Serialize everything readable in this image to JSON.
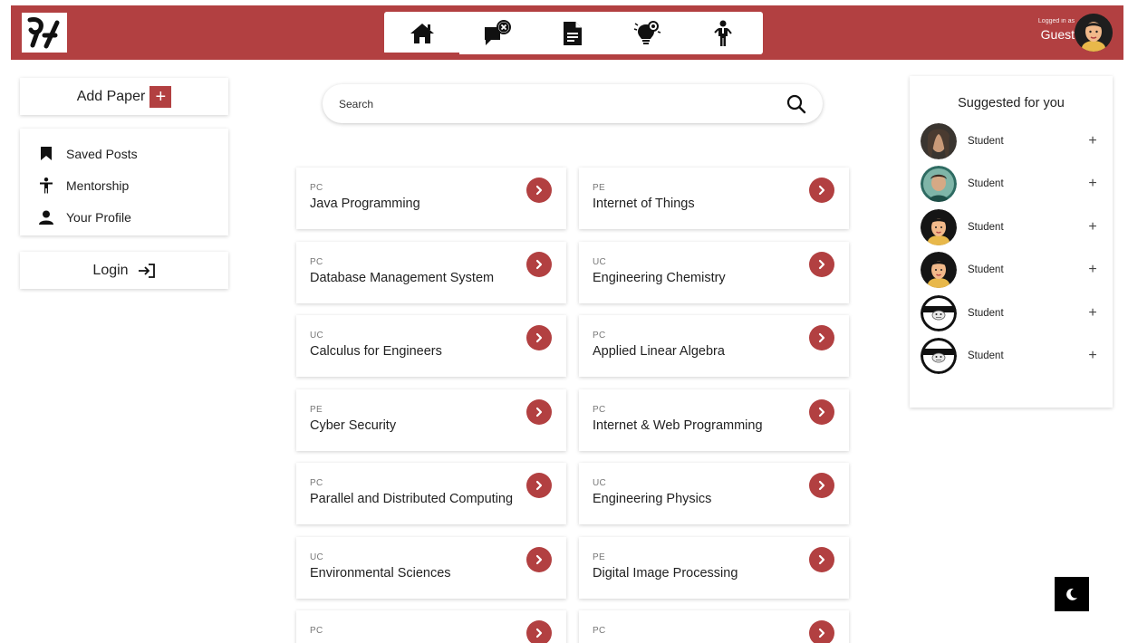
{
  "header": {
    "logged_in_label": "Logged in as",
    "user_name": "Guest",
    "nav": [
      {
        "icon": "home-icon",
        "active": true
      },
      {
        "icon": "chat-close-icon",
        "active": false
      },
      {
        "icon": "document-icon",
        "active": false
      },
      {
        "icon": "lightbulb-gear-icon",
        "active": false
      },
      {
        "icon": "mentor-person-icon",
        "active": false
      }
    ]
  },
  "sidebar": {
    "add_paper_label": "Add Paper",
    "menu": [
      {
        "label": "Saved Posts",
        "icon": "bookmark-icon"
      },
      {
        "label": "Mentorship",
        "icon": "person-stand-icon"
      },
      {
        "label": "Your Profile",
        "icon": "user-icon"
      }
    ],
    "login_label": "Login"
  },
  "search": {
    "placeholder": "Search"
  },
  "papers": [
    {
      "cat": "PC",
      "title": "Java Programming"
    },
    {
      "cat": "PE",
      "title": "Internet of Things"
    },
    {
      "cat": "PC",
      "title": "Database Management System"
    },
    {
      "cat": "UC",
      "title": "Engineering Chemistry"
    },
    {
      "cat": "UC",
      "title": "Calculus for Engineers"
    },
    {
      "cat": "PC",
      "title": "Applied Linear Algebra"
    },
    {
      "cat": "PE",
      "title": "Cyber Security"
    },
    {
      "cat": "PC",
      "title": "Internet & Web Programming"
    },
    {
      "cat": "PC",
      "title": "Parallel and Distributed Computing"
    },
    {
      "cat": "UC",
      "title": "Engineering Physics"
    },
    {
      "cat": "UC",
      "title": "Environmental Sciences"
    },
    {
      "cat": "PE",
      "title": "Digital Image Processing"
    },
    {
      "cat": "PC",
      "title": ""
    },
    {
      "cat": "PC",
      "title": ""
    }
  ],
  "suggested": {
    "title": "Suggested for you",
    "users": [
      {
        "name": "Student",
        "avatar": "photo-woman"
      },
      {
        "name": "Student",
        "avatar": "photo-man"
      },
      {
        "name": "Student",
        "avatar": "cartoon-female"
      },
      {
        "name": "Student",
        "avatar": "cartoon-female"
      },
      {
        "name": "Student",
        "avatar": "cartoon-mask"
      },
      {
        "name": "Student",
        "avatar": "cartoon-mask"
      }
    ],
    "add_symbol": "+"
  },
  "colors": {
    "brand": "#b24041",
    "dark": "#000000"
  }
}
